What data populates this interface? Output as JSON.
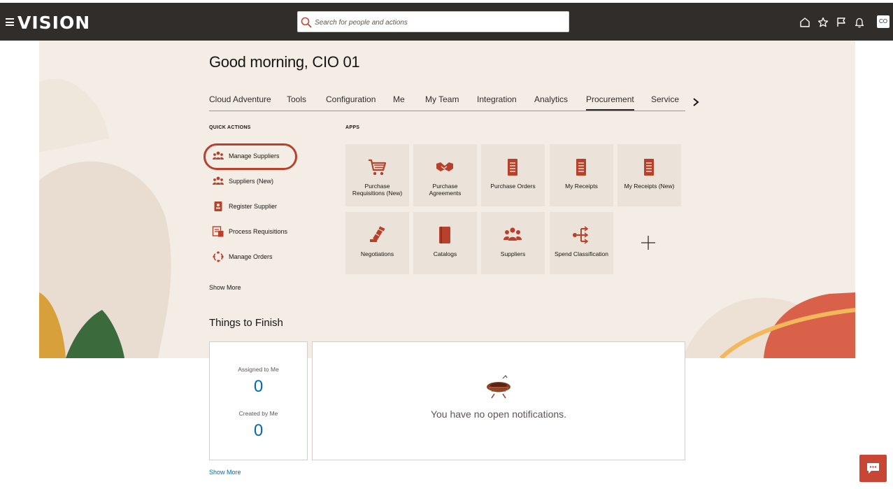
{
  "header": {
    "logo": "VISION",
    "search_placeholder": "Search for people and actions",
    "avatar_initials": "CO",
    "icons": [
      "hamburger-icon",
      "home-icon",
      "star-icon",
      "flag-icon",
      "bell-icon"
    ]
  },
  "greeting": "Good morning, CIO 01",
  "tabs": [
    {
      "label": "Cloud Adventure",
      "active": false
    },
    {
      "label": "Tools",
      "active": false
    },
    {
      "label": "Configuration",
      "active": false
    },
    {
      "label": "Me",
      "active": false
    },
    {
      "label": "My Team",
      "active": false
    },
    {
      "label": "Integration",
      "active": false
    },
    {
      "label": "Analytics",
      "active": false
    },
    {
      "label": "Procurement",
      "active": true
    },
    {
      "label": "Service",
      "active": false
    }
  ],
  "quick_actions": {
    "title": "QUICK ACTIONS",
    "items": [
      {
        "label": "Manage Suppliers",
        "icon": "people-icon",
        "highlighted": true
      },
      {
        "label": "Suppliers (New)",
        "icon": "people-icon"
      },
      {
        "label": "Register Supplier",
        "icon": "id-badge-icon"
      },
      {
        "label": "Process Requisitions",
        "icon": "list-icon"
      },
      {
        "label": "Manage Orders",
        "icon": "cycle-icon"
      }
    ],
    "show_more": "Show More"
  },
  "apps": {
    "title": "APPS",
    "tiles": [
      {
        "label": "Purchase Requisitions (New)",
        "icon": "cart-icon"
      },
      {
        "label": "Purchase Agreements",
        "icon": "handshake-icon"
      },
      {
        "label": "Purchase Orders",
        "icon": "document-icon"
      },
      {
        "label": "My Receipts",
        "icon": "document-icon"
      },
      {
        "label": "My Receipts (New)",
        "icon": "document-icon"
      },
      {
        "label": "Negotiations",
        "icon": "gavel-icon"
      },
      {
        "label": "Catalogs",
        "icon": "book-icon"
      },
      {
        "label": "Suppliers",
        "icon": "people-icon"
      },
      {
        "label": "Spend Classification",
        "icon": "classification-icon"
      }
    ],
    "add_icon": "plus-icon"
  },
  "things_to_finish": {
    "title": "Things to Finish",
    "assigned_label": "Assigned to Me",
    "assigned_count": "0",
    "created_label": "Created by Me",
    "created_count": "0",
    "empty_message": "You have no open notifications.",
    "show_more": "Show More"
  },
  "colors": {
    "header_bg": "#312d2a",
    "panel_bg": "#f3ede6",
    "tile_bg": "#ebe3d9",
    "accent_red": "#c74634",
    "link_blue": "#006bb1",
    "highlight_ring": "#b8412b"
  }
}
